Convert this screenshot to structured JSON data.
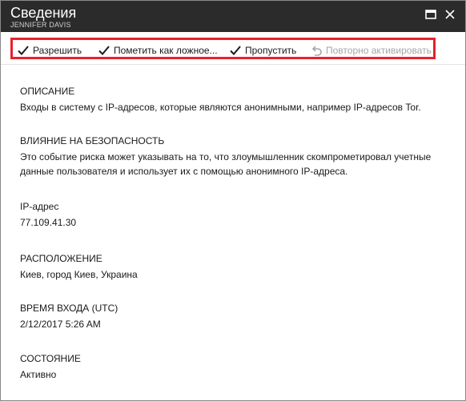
{
  "header": {
    "title": "Сведения",
    "subtitle": "JENNIFER DAVIS",
    "maximize_icon": "maximize-icon",
    "close_icon": "close-icon"
  },
  "toolbar": {
    "allow_label": "Разрешить",
    "false_label": "Пометить как ложное...",
    "skip_label": "Пропустить",
    "reactivate_label": "Повторно активировать",
    "highlight_color": "#e8212b"
  },
  "details": {
    "description": {
      "label": "ОПИСАНИЕ",
      "value": "Входы в систему с IP-адресов, которые являются анонимными, например IP-адресов Tor."
    },
    "impact": {
      "label": "ВЛИЯНИЕ НА БЕЗОПАСНОСТЬ",
      "value": "Это событие риска может указывать на то, что злоумышленник скомпрометировал учетные данные пользователя и использует их с помощью анонимного IP-адреса."
    },
    "ip": {
      "label": "IP-адрес",
      "value": "77.109.41.30"
    },
    "location": {
      "label": "РАСПОЛОЖЕНИЕ",
      "value": "Киев, город Киев, Украина"
    },
    "signin_time": {
      "label": "ВРЕМЯ ВХОДА (UTC)",
      "value": "2/12/2017 5:26 AM"
    },
    "status": {
      "label": "СОСТОЯНИЕ",
      "value": "Активно"
    }
  }
}
